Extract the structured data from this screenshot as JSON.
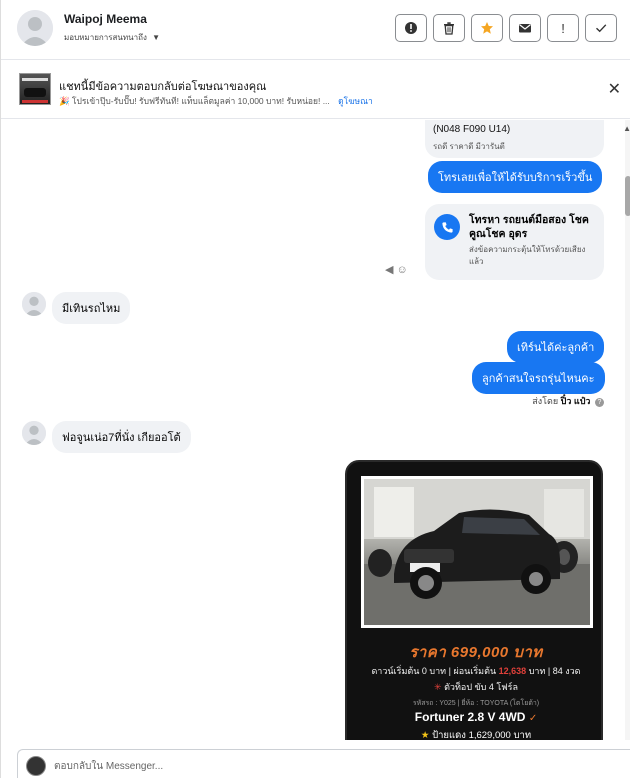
{
  "header": {
    "name": "Waipoj Meema",
    "assign_label": "มอบหมายการสนทนาถึง",
    "buttons": [
      {
        "name": "report-spam-button",
        "glyph": "!",
        "icon": "alert-circle-icon"
      },
      {
        "name": "delete-button",
        "icon": "trash-icon"
      },
      {
        "name": "star-button",
        "icon": "star-icon",
        "color": "#f5a623"
      },
      {
        "name": "mark-unread-button",
        "icon": "envelope-icon"
      },
      {
        "name": "follow-up-button",
        "glyph": "!",
        "icon": "exclamation-icon"
      },
      {
        "name": "mark-done-button",
        "glyph": "✓",
        "icon": "check-icon"
      }
    ]
  },
  "ad": {
    "title": "แชทนี้มีข้อความตอบกลับต่อโฆษณาของคุณ",
    "description": "🎉 โปรเข้าปุ๊บ-รับปั๊บ! รับฟรีทันที! แท็บแล็ตมูลค่า 10,000 บาท! รับหน่อย! ...",
    "link": "ดูโฆษณา"
  },
  "messages": {
    "card_line1": "(N048 F090 U14)",
    "card_line2": "รถดี ราคาดี มีวารันตี",
    "blue_call_cta": "โทรเลยเพื่อให้ได้รับบริการเร็วขึ้น",
    "call_title": "โทรหา รถยนต์มือสอง โชคคูณโชค อุดร",
    "call_subtitle": "ส่งข้อความกระตุ้นให้โทรด้วยเสียงแล้ว",
    "customer_1": "มีเทินรถไหม",
    "page_reply_1": "เทิร์นได้ค่ะลูกค้า",
    "page_reply_2": "ลูกค้าสนใจรถรุ่นไหนคะ",
    "sent_by_prefix": "ส่งโดย",
    "sent_by_name": "ปิ๋ว แป๋ว",
    "customer_2": "ฟอจูนเน่อ7ที่นั่ง เกียออโต้"
  },
  "product": {
    "price": "ราคา 699,000 บาท",
    "finance_prefix": "ดาวน์เริ่มต้น 0 บาท | ผ่อนเริ่มต้น",
    "finance_amount": "12,638",
    "finance_suffix": "บาท | 84 งวด",
    "feature": "ตัวท็อป ขับ 4 โฟร์ล",
    "meta": "รหัสรถ : Y025 | ยี่ห้อ : TOYOTA (โตโยต้า)",
    "model": "Fortuner 2.8 V 4WD",
    "plate": "ป้ายแดง 1,629,000 บาท"
  },
  "composer": {
    "placeholder": "ตอบกลับใน Messenger..."
  },
  "colors": {
    "messenger_blue": "#1877f2",
    "bubble_grey": "#f0f2f5",
    "price_orange": "#e8772e",
    "star_yellow": "#f5a623"
  }
}
